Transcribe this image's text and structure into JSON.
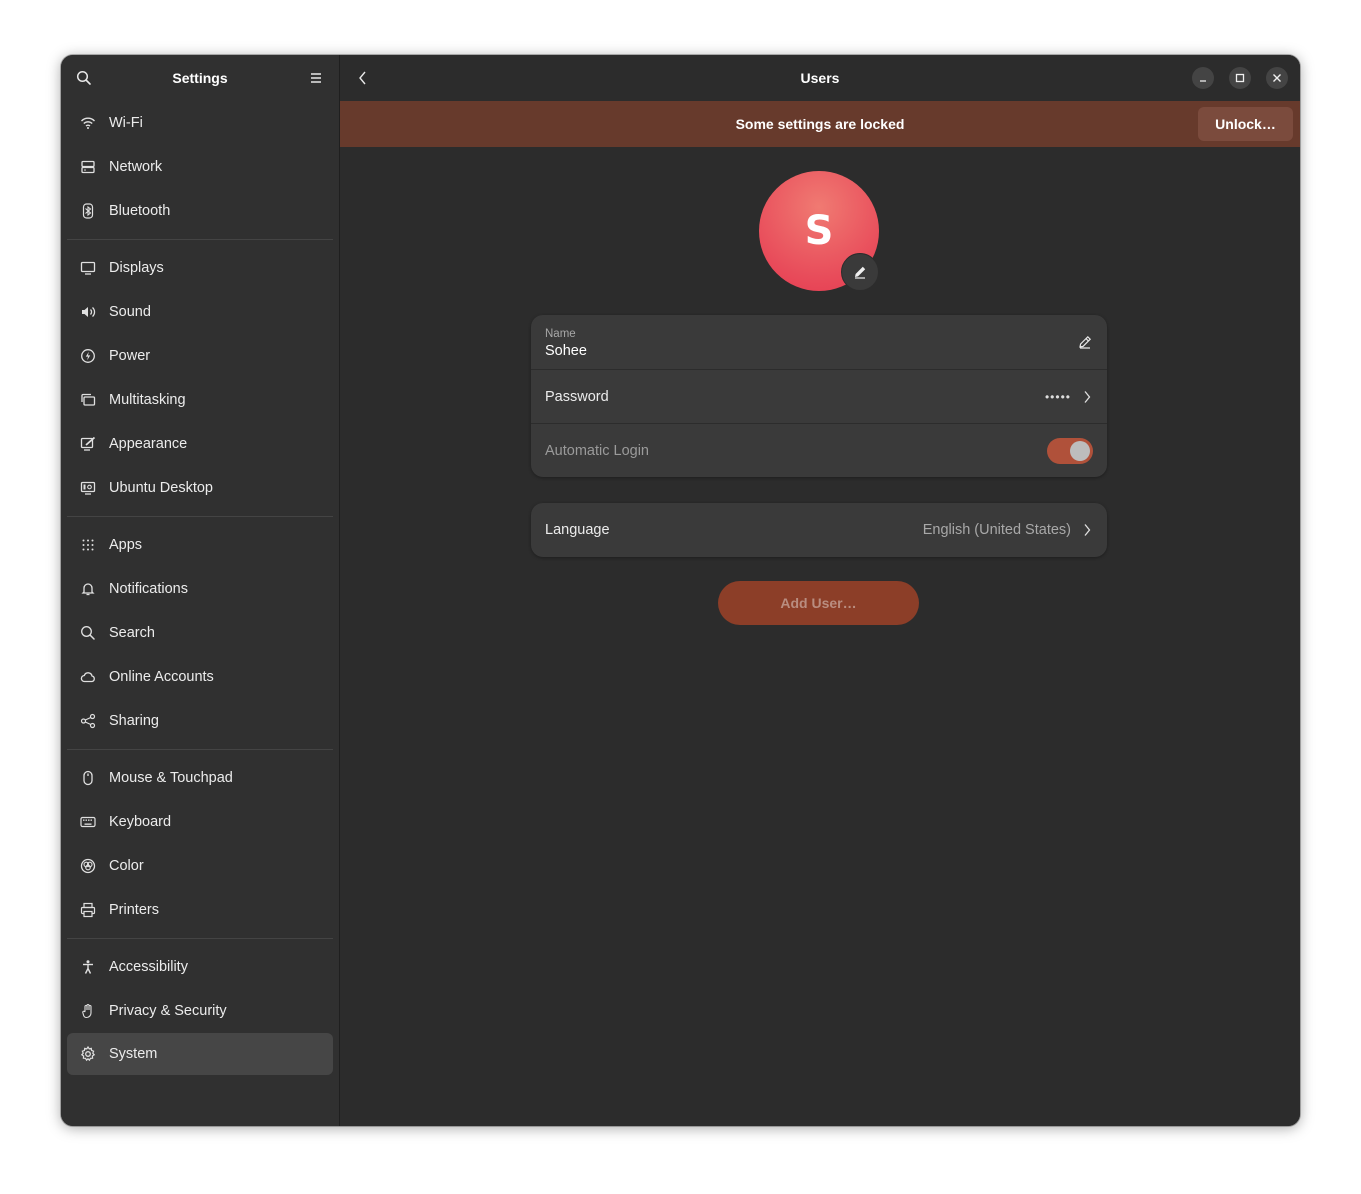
{
  "sidebar": {
    "title": "Settings",
    "search_icon": "search-icon",
    "menu_icon": "hamburger-menu-icon",
    "groups": [
      [
        {
          "label": "Wi-Fi",
          "icon": "wifi-icon"
        },
        {
          "label": "Network",
          "icon": "network-icon"
        },
        {
          "label": "Bluetooth",
          "icon": "bluetooth-icon"
        }
      ],
      [
        {
          "label": "Displays",
          "icon": "display-icon"
        },
        {
          "label": "Sound",
          "icon": "speaker-icon"
        },
        {
          "label": "Power",
          "icon": "power-icon"
        },
        {
          "label": "Multitasking",
          "icon": "multitasking-icon"
        },
        {
          "label": "Appearance",
          "icon": "appearance-icon"
        },
        {
          "label": "Ubuntu Desktop",
          "icon": "ubuntu-desktop-icon"
        }
      ],
      [
        {
          "label": "Apps",
          "icon": "apps-grid-icon"
        },
        {
          "label": "Notifications",
          "icon": "bell-icon"
        },
        {
          "label": "Search",
          "icon": "search-icon"
        },
        {
          "label": "Online Accounts",
          "icon": "cloud-icon"
        },
        {
          "label": "Sharing",
          "icon": "share-icon"
        }
      ],
      [
        {
          "label": "Mouse & Touchpad",
          "icon": "mouse-icon"
        },
        {
          "label": "Keyboard",
          "icon": "keyboard-icon"
        },
        {
          "label": "Color",
          "icon": "color-icon"
        },
        {
          "label": "Printers",
          "icon": "printer-icon"
        }
      ],
      [
        {
          "label": "Accessibility",
          "icon": "accessibility-icon"
        },
        {
          "label": "Privacy & Security",
          "icon": "hand-icon"
        },
        {
          "label": "System",
          "icon": "gear-icon",
          "selected": true
        }
      ]
    ]
  },
  "header": {
    "title": "Users",
    "back_icon": "chevron-left-icon",
    "window_controls": [
      "minimize-icon",
      "maximize-icon",
      "close-icon"
    ]
  },
  "banner": {
    "text": "Some settings are locked",
    "button_label": "Unlock…",
    "color": "#673a2c"
  },
  "user": {
    "avatar_letter": "S",
    "avatar_color": "#e84b5a",
    "name_caption": "Name",
    "name_value": "Sohee",
    "password_label": "Password",
    "password_mask": "•••••",
    "auto_login_label": "Automatic Login",
    "auto_login_enabled": true,
    "language_label": "Language",
    "language_value": "English (United States)"
  },
  "actions": {
    "add_user_label": "Add User…"
  },
  "colors": {
    "accent": "#b0513a",
    "button_accent": "#8c3e28",
    "window_bg": "#2c2c2c",
    "sidebar_bg": "#303030"
  }
}
